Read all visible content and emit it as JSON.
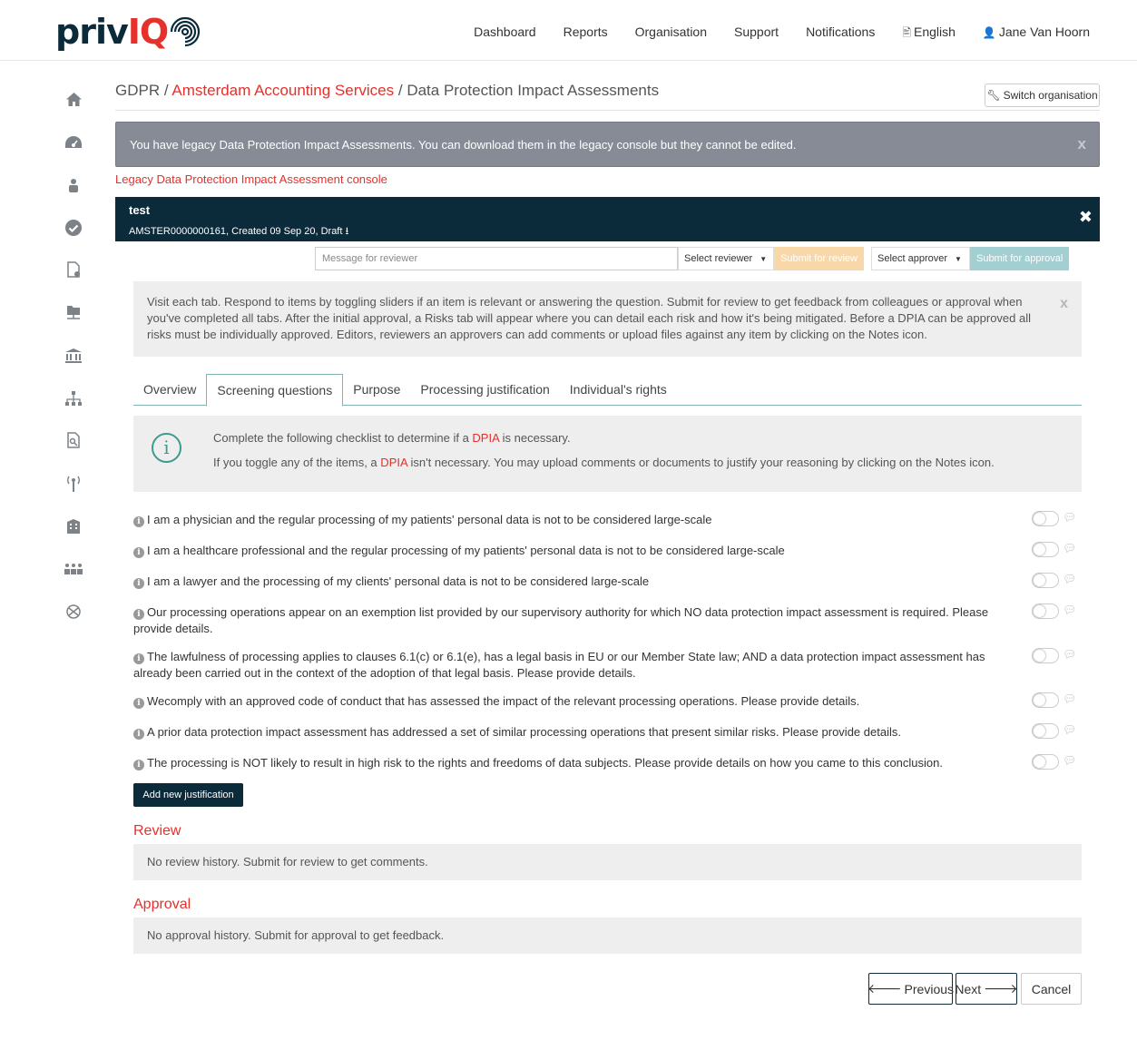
{
  "brand": {
    "name_left": "priv",
    "name_right": "IQ"
  },
  "topnav": [
    {
      "label": "Dashboard",
      "icon": ""
    },
    {
      "label": "Reports",
      "icon": ""
    },
    {
      "label": "Organisation",
      "icon": ""
    },
    {
      "label": "Support",
      "icon": ""
    },
    {
      "label": "Notifications",
      "icon": ""
    },
    {
      "label": "English",
      "icon": "language-icon"
    },
    {
      "label": "Jane Van Hoorn",
      "icon": "user-icon"
    }
  ],
  "sidebar": [
    "home-icon",
    "dashboard-icon",
    "person-icon",
    "check-circle-icon",
    "document-gear-icon",
    "folder-network-icon",
    "bank-icon",
    "org-chart-icon",
    "document-search-icon",
    "broadcast-icon",
    "building-icon",
    "group-icon",
    "no-transfer-icon"
  ],
  "breadcrumb": {
    "part1": "GDPR",
    "sep": "/",
    "org": "Amsterdam Accounting Services",
    "page": "Data Protection Impact Assessments"
  },
  "switch_org": "Switch organisation",
  "legacy_alert": "You have legacy Data Protection Impact Assessments. You can download them in the legacy console but they cannot be edited.",
  "legacy_link": "Legacy Data Protection Impact Assessment console",
  "dpia": {
    "title": "test",
    "meta": "AMSTER0000000161, Created 09 Sep 20, Draft"
  },
  "submit": {
    "message_placeholder": "Message for reviewer",
    "select_reviewer": "Select reviewer",
    "submit_review": "Submit for review",
    "select_approver": "Select approver",
    "submit_approval": "Submit for approval"
  },
  "info_text": "Visit each tab. Respond to items by toggling sliders if an item is relevant or answering the question. Submit for review to get feedback from colleagues or approval when you've completed all tabs. After the initial approval, a Risks tab will appear where you can detail each risk and how it's being mitigated. Before a DPIA can be approved all risks must be individually approved. Editors, reviewers an approvers can add comments or upload files against any item by clicking on the Notes icon.",
  "tabs": [
    "Overview",
    "Screening questions",
    "Purpose",
    "Processing justification",
    "Individual's rights"
  ],
  "active_tab": "Screening questions",
  "checklist": {
    "l1_a": "Complete the following checklist to determine if a ",
    "l1_b": "DPIA",
    "l1_c": " is necessary.",
    "l2_a": "If you toggle any of the items, a ",
    "l2_b": "DPIA",
    "l2_c": " isn't necessary. You may upload comments or documents to justify your reasoning by clicking on the Notes icon."
  },
  "questions": [
    {
      "text": "I am a physician and the regular processing of my patients' personal data is not to be considered large-scale",
      "toggled": false
    },
    {
      "text": "I am a healthcare professional and the regular processing of my patients' personal data is not to be considered large-scale",
      "toggled": false
    },
    {
      "text": "I am a lawyer and the processing of my clients' personal data is not to be considered large-scale",
      "toggled": false
    },
    {
      "text": "Our processing operations appear on an exemption list provided by our supervisory authority for which NO data protection impact assessment is required. Please provide details.",
      "toggled": false
    },
    {
      "text": "The lawfulness of processing applies to clauses 6.1(c) or 6.1(e), has a legal basis in EU or our Member State law; AND a data protection impact assessment has already been carried out in the context of the adoption of that legal basis. Please provide details.",
      "toggled": false
    },
    {
      "text": "Wecomply with an approved code of conduct that has assessed the impact of the relevant processing operations. Please provide details.",
      "toggled": false
    },
    {
      "text": "A prior data protection impact assessment has addressed a set of similar processing operations that present similar risks. Please provide details.",
      "toggled": false
    },
    {
      "text": "The processing is NOT likely to result in high risk to the rights and freedoms of data subjects. Please provide details on how you came to this conclusion.",
      "toggled": false
    }
  ],
  "add_justification": "Add new justification",
  "review": {
    "heading": "Review",
    "text": "No review history. Submit for review to get comments."
  },
  "approval": {
    "heading": "Approval",
    "text": "No approval history. Submit for approval to get feedback."
  },
  "footer": {
    "previous": "Previous",
    "next": "Next",
    "cancel": "Cancel"
  }
}
